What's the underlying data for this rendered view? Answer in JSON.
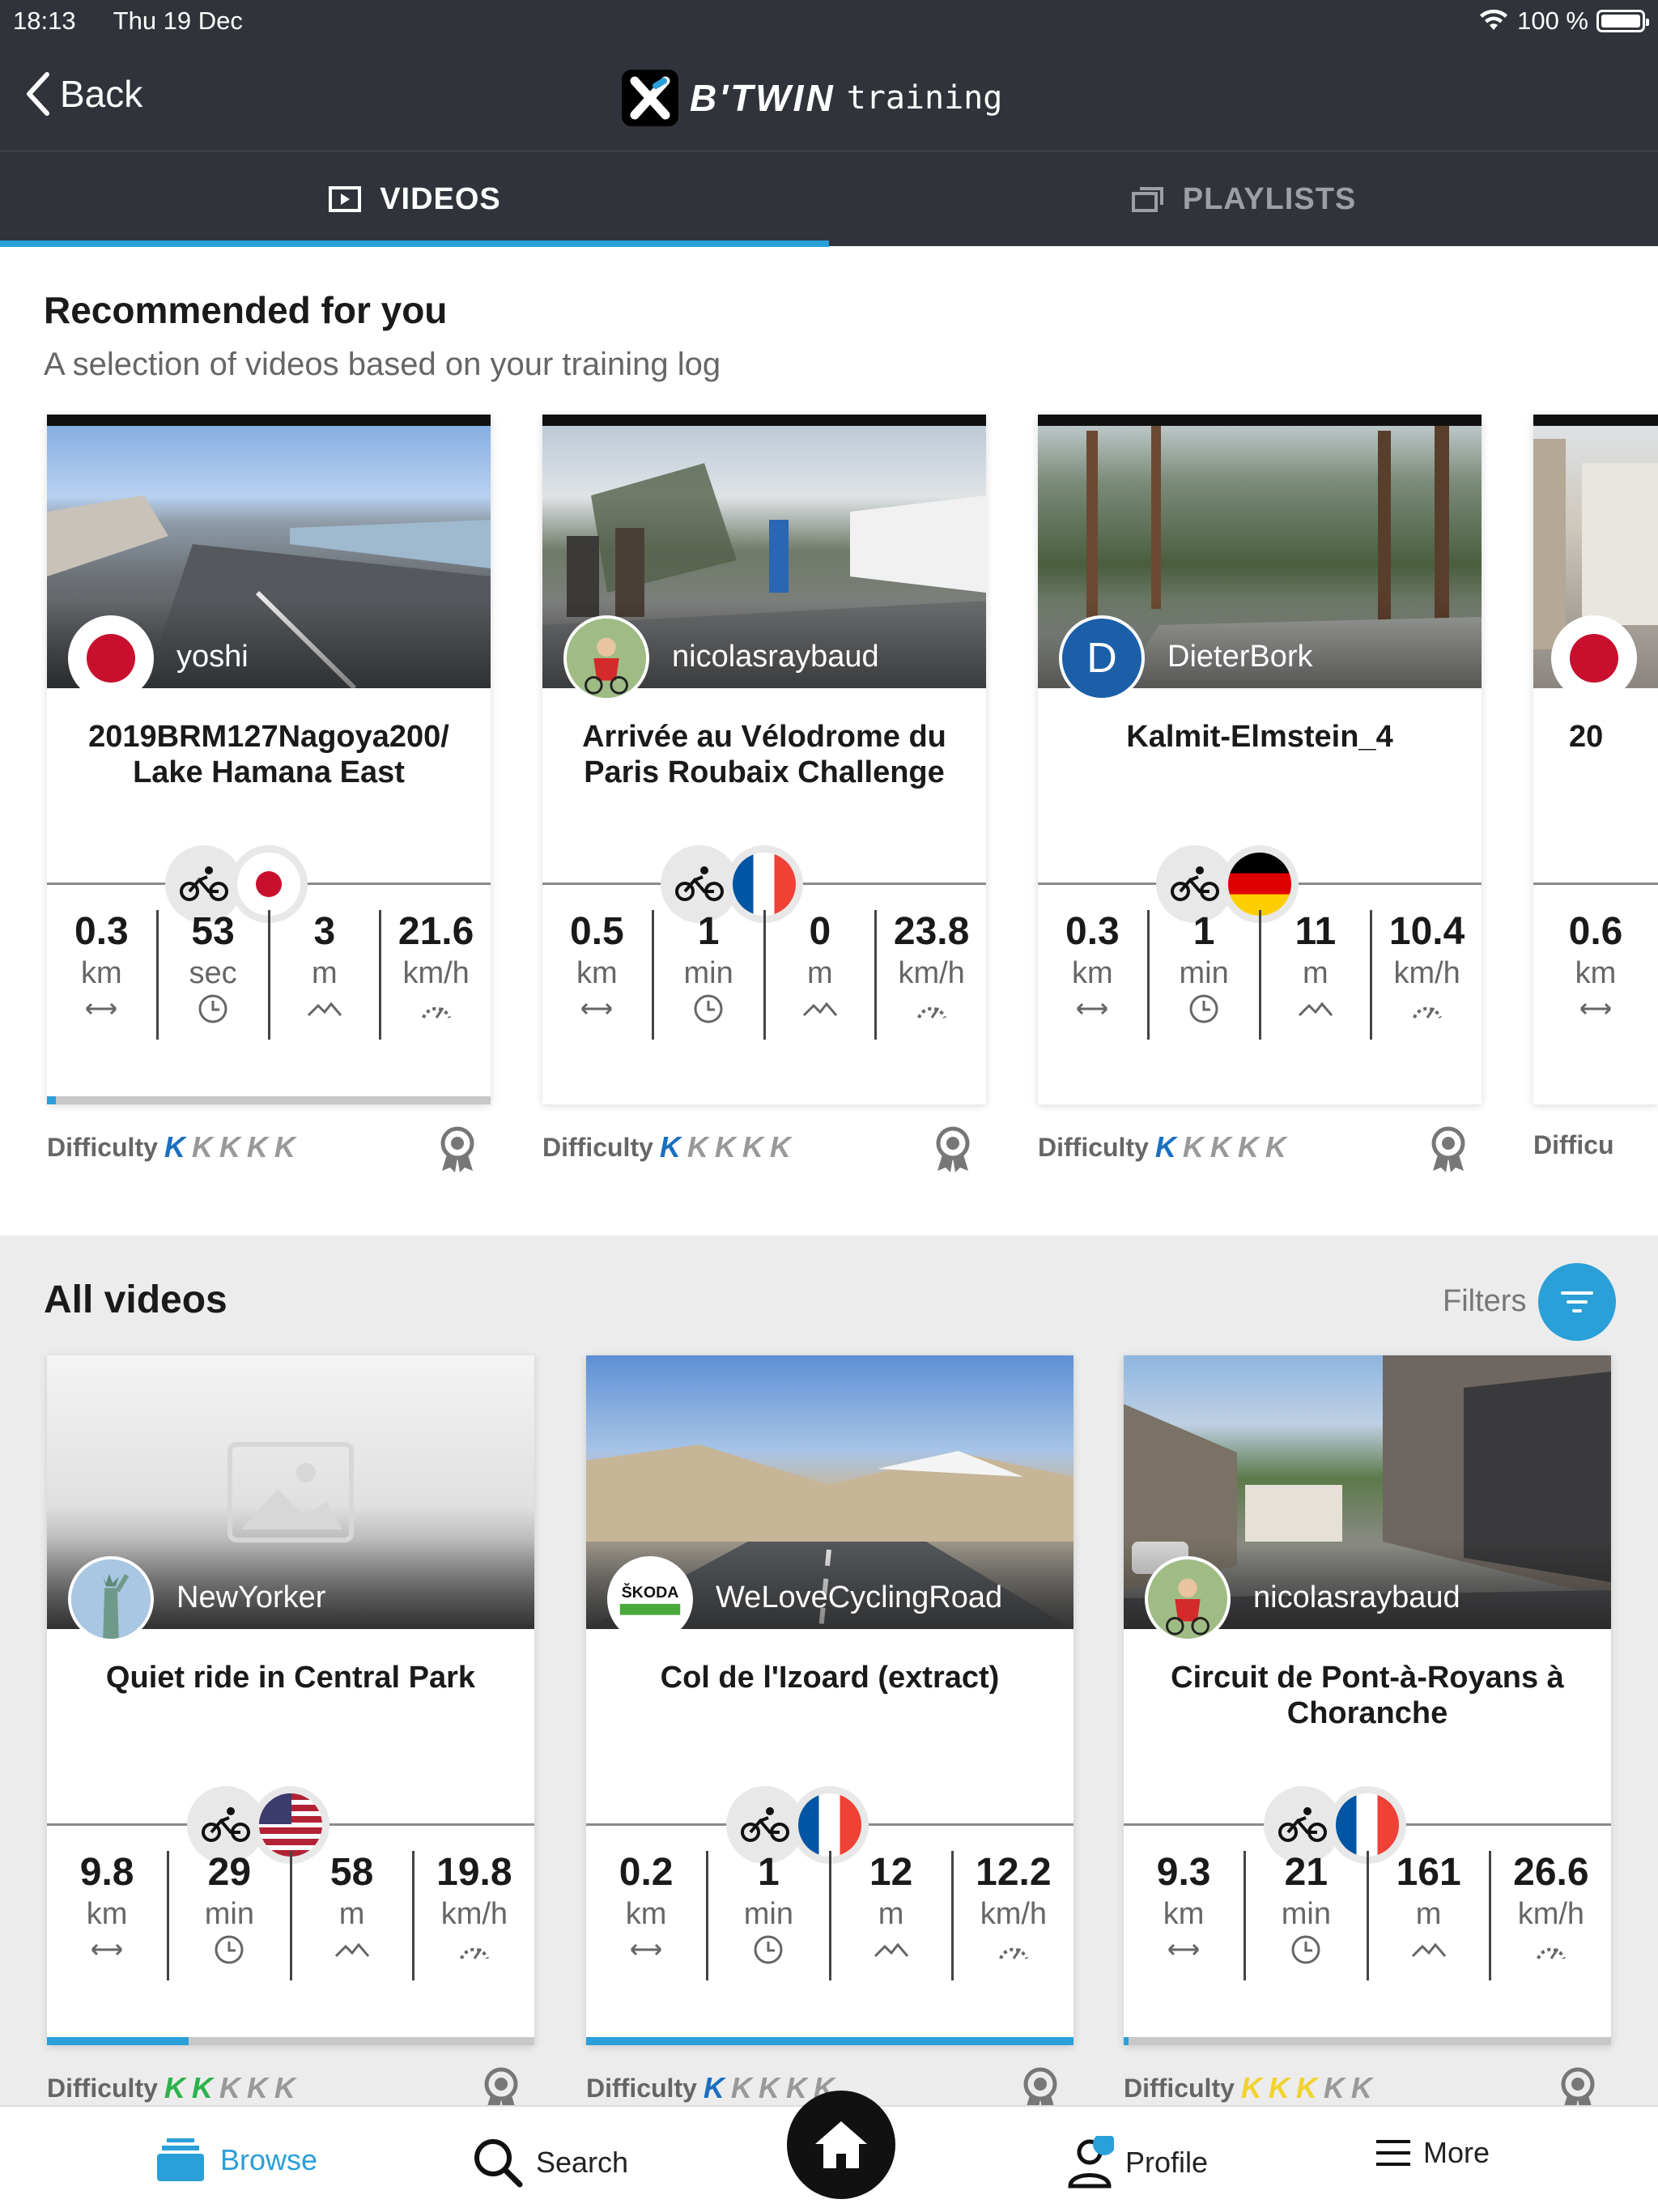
{
  "status_bar": {
    "time": "18:13",
    "date": "Thu 19 Dec",
    "battery": "100 %"
  },
  "header": {
    "back_label": "Back",
    "logo_brand": "B'TWIN",
    "logo_sub": "training"
  },
  "tabs": [
    {
      "label": "VIDEOS",
      "active": true
    },
    {
      "label": "PLAYLISTS",
      "active": false
    }
  ],
  "recommended": {
    "title": "Recommended for you",
    "subtitle": "A selection of videos based on your training log",
    "cards": [
      {
        "author": "yoshi",
        "title": "2019BRM127Nagoya200/ Lake Hamana East",
        "country": "Japan",
        "stats": [
          {
            "value": "0.3",
            "unit": "km"
          },
          {
            "value": "53",
            "unit": "sec"
          },
          {
            "value": "3",
            "unit": "m"
          },
          {
            "value": "21.6",
            "unit": "km/h"
          }
        ],
        "progress": 0.02,
        "difficulty_label": "Difficulty",
        "difficulty_level": 1,
        "difficulty_color": "#1a6fbf"
      },
      {
        "author": "nicolasraybaud",
        "title": "Arrivée au Vélodrome du Paris Roubaix Challenge",
        "country": "France",
        "stats": [
          {
            "value": "0.5",
            "unit": "km"
          },
          {
            "value": "1",
            "unit": "min"
          },
          {
            "value": "0",
            "unit": "m"
          },
          {
            "value": "23.8",
            "unit": "km/h"
          }
        ],
        "progress": 0,
        "difficulty_label": "Difficulty",
        "difficulty_level": 1,
        "difficulty_color": "#1a6fbf"
      },
      {
        "author": "DieterBork",
        "avatar_letter": "D",
        "title": "Kalmit-Elmstein_4",
        "country": "Germany",
        "stats": [
          {
            "value": "0.3",
            "unit": "km"
          },
          {
            "value": "1",
            "unit": "min"
          },
          {
            "value": "11",
            "unit": "m"
          },
          {
            "value": "10.4",
            "unit": "km/h"
          }
        ],
        "progress": 0,
        "difficulty_label": "Difficulty",
        "difficulty_level": 1,
        "difficulty_color": "#1a6fbf"
      },
      {
        "author": "",
        "title": "20",
        "country": "Japan",
        "stats": [
          {
            "value": "0.6",
            "unit": "km"
          }
        ],
        "progress": 0,
        "difficulty_label": "Difficu",
        "difficulty_level": 0,
        "difficulty_color": "#1a6fbf"
      }
    ]
  },
  "all_videos": {
    "title": "All videos",
    "filters_label": "Filters",
    "cards": [
      {
        "author": "NewYorker",
        "title": "Quiet ride in Central Park",
        "country": "USA",
        "stats": [
          {
            "value": "9.8",
            "unit": "km"
          },
          {
            "value": "29",
            "unit": "min"
          },
          {
            "value": "58",
            "unit": "m"
          },
          {
            "value": "19.8",
            "unit": "km/h"
          }
        ],
        "progress": 0.29,
        "difficulty_label": "Difficulty",
        "difficulty_level": 2,
        "difficulty_color": "#2bb24c"
      },
      {
        "author": "WeLoveCyclingRoad",
        "title": "Col de l'Izoard (extract)",
        "country": "France",
        "stats": [
          {
            "value": "0.2",
            "unit": "km"
          },
          {
            "value": "1",
            "unit": "min"
          },
          {
            "value": "12",
            "unit": "m"
          },
          {
            "value": "12.2",
            "unit": "km/h"
          }
        ],
        "progress": 1.0,
        "difficulty_label": "Difficulty",
        "difficulty_level": 1,
        "difficulty_color": "#1a6fbf"
      },
      {
        "author": "nicolasraybaud",
        "title": "Circuit de Pont-à-Royans à Choranche",
        "country": "France",
        "stats": [
          {
            "value": "9.3",
            "unit": "km"
          },
          {
            "value": "21",
            "unit": "min"
          },
          {
            "value": "161",
            "unit": "m"
          },
          {
            "value": "26.6",
            "unit": "km/h"
          }
        ],
        "progress": 0.01,
        "difficulty_label": "Difficulty",
        "difficulty_level": 3,
        "difficulty_color": "#f2d22e"
      }
    ]
  },
  "bottom_nav": {
    "browse": "Browse",
    "search": "Search",
    "profile": "Profile",
    "more": "More"
  },
  "colors": {
    "accent": "#2a9fd8",
    "header_bg": "#30343a"
  },
  "icons": [
    "chevron-left-icon",
    "wifi-icon",
    "battery-icon",
    "video-icon",
    "playlist-icon",
    "bike-icon",
    "clock-icon",
    "distance-icon",
    "elevation-icon",
    "speed-icon",
    "medal-icon",
    "filter-icon",
    "home-icon",
    "search-icon",
    "profile-icon",
    "menu-icon"
  ]
}
